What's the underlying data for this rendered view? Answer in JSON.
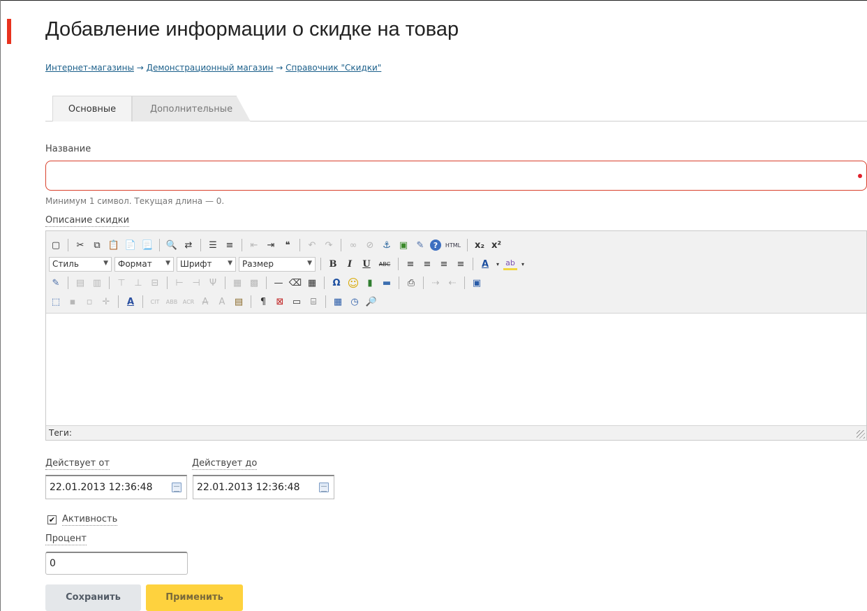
{
  "page": {
    "title": "Добавление информации о скидке на товар"
  },
  "breadcrumb": {
    "items": [
      "Интернет-магазины",
      "Демонстрационный магазин",
      "Справочник \"Скидки\""
    ],
    "separator": "→"
  },
  "tabs": [
    {
      "label": "Основные",
      "active": true
    },
    {
      "label": "Дополнительные",
      "active": false
    }
  ],
  "form": {
    "name": {
      "label": "Название",
      "value": "",
      "hint": "Минимум 1 символ. Текущая длина — 0."
    },
    "description": {
      "label": "Описание скидки",
      "status_label": "Теги:",
      "combos": [
        "Стиль",
        "Формат",
        "Шрифт",
        "Размер"
      ]
    },
    "active_from": {
      "label": "Действует от",
      "value": "22.01.2013 12:36:48"
    },
    "active_to": {
      "label": "Действует до",
      "value": "22.01.2013 12:36:48"
    },
    "active": {
      "label": "Активность",
      "checked": true,
      "mark": "✔"
    },
    "percent": {
      "label": "Процент",
      "value": "0"
    }
  },
  "buttons": {
    "save": "Сохранить",
    "apply": "Применить"
  },
  "toolbar_glyphs": {
    "new": "▢",
    "cut": "✂",
    "copy": "⧉",
    "paste": "📋",
    "paste_text": "📄",
    "paste_word": "📃",
    "find": "🔍",
    "replace": "⇄",
    "bullets": "☰",
    "numbers": "≡",
    "outdent": "⇤",
    "indent": "⇥",
    "blockquote": "❝",
    "undo": "↶",
    "redo": "↷",
    "link": "∞",
    "unlink": "⊘",
    "anchor": "⚓",
    "image": "▣",
    "cleanup": "✎",
    "help": "?",
    "html": "HTML",
    "sub": "x₂",
    "sup": "x²",
    "bold": "B",
    "italic": "I",
    "underline": "U",
    "strike": "ABC",
    "align_left": "≡",
    "align_center": "≡",
    "align_right": "≡",
    "align_justify": "≡",
    "forecolor": "A",
    "backcolor": "ab",
    "hr": "—",
    "omega": "Ω",
    "smiley": "☺",
    "pilcrow": "¶",
    "print": "⎙",
    "clock": "◷",
    "preview": "🔎"
  }
}
